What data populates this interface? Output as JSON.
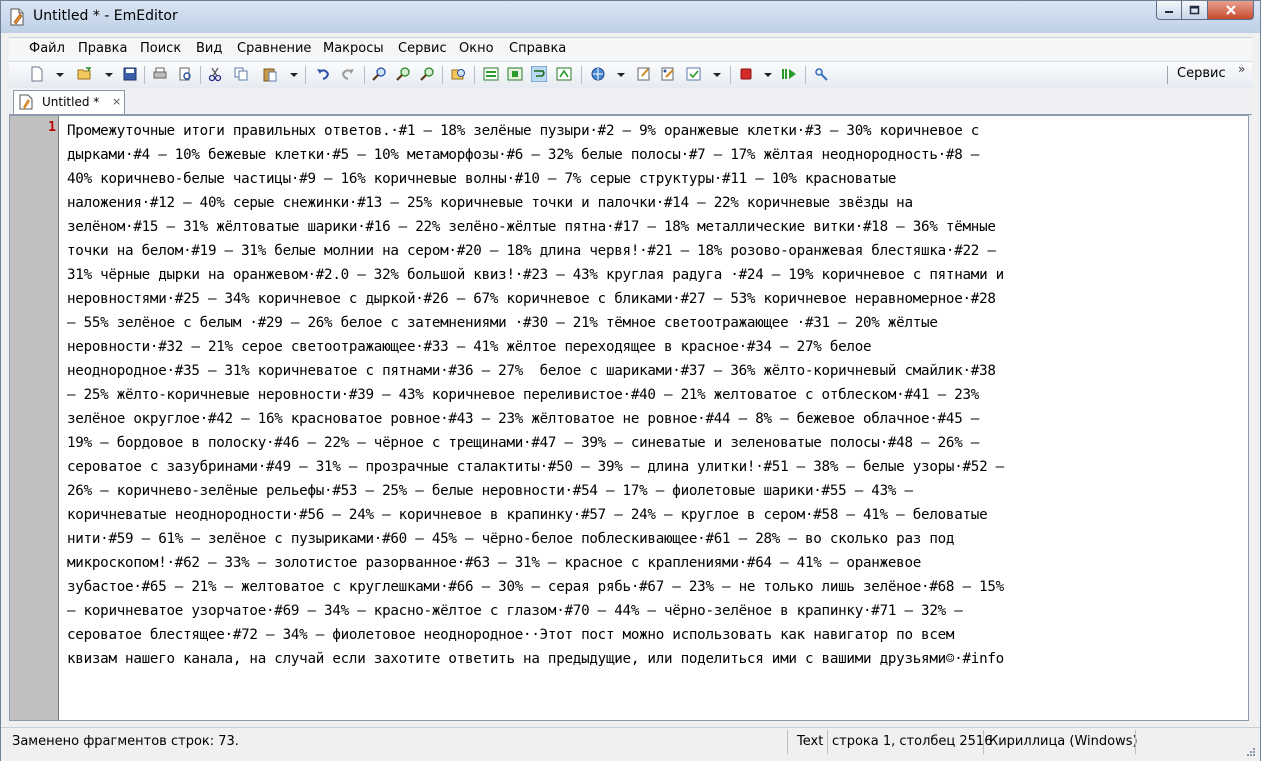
{
  "window": {
    "title": "Untitled * - EmEditor"
  },
  "menu": [
    "Файл",
    "Правка",
    "Поиск",
    "Вид",
    "Сравнение",
    "Макросы",
    "Сервис",
    "Окно",
    "Справка"
  ],
  "toolbar": {
    "service_label": "Сервис",
    "chevron": "»"
  },
  "tab": {
    "label": "Untitled *",
    "close": "×"
  },
  "editor": {
    "line_number": "1",
    "lines": [
      "Промежуточные итоги правильных ответов.·#1 – 18% зелёные пузыри·#2 – 9% оранжевые клетки·#3 – 30% коричневое с",
      "дырками·#4 – 10% бежевые клетки·#5 – 10% метаморфозы·#6 – 32% белые полосы·#7 – 17% жёлтая неоднородность·#8 –",
      "40% коричнево-белые частицы·#9 – 16% коричневые волны·#10 – 7% серые структуры·#11 – 10% красноватые",
      "наложения·#12 – 40% серые снежинки·#13 – 25% коричневые точки и палочки·#14 – 22% коричневые звёзды на",
      "зелёном·#15 – 31% жёлтоватые шарики·#16 – 22% зелёно-жёлтые пятна·#17 – 18% металлические витки·#18 – 36% тёмные",
      "точки на белом·#19 – 31% белые молнии на сером·#20 – 18% длина червя!·#21 – 18% розово-оранжевая блестяшка·#22 –",
      "31% чёрные дырки на оранжевом·#2.0 – 32% большой квиз!·#23 – 43% круглая радуга ·#24 – 19% коричневое с пятнами и",
      "неровностями·#25 – 34% коричневое с дыркой·#26 – 67% коричневое с бликами·#27 – 53% коричневое неравномерное·#28",
      "– 55% зелёное с белым ·#29 – 26% белое с затемнениями ·#30 – 21% тёмное светоотражающее ·#31 – 20% жёлтые",
      "неровности·#32 – 21% серое светоотражающее·#33 – 41% жёлтое переходящее в красное·#34 – 27% белое",
      "неоднородное·#35 – 31% коричневатое с пятнами·#36 – 27%  белое с шариками·#37 – 36% жёлто-коричневый смайлик·#38",
      "– 25% жёлто-коричневые неровности·#39 – 43% коричневое переливистое·#40 – 21% желтоватое с отблеском·#41 – 23%",
      "зелёное округлое·#42 – 16% красноватое ровное·#43 – 23% жёлтоватое не ровное·#44 – 8% – бежевое облачное·#45 –",
      "19% – бордовое в полоску·#46 – 22% – чёрное с трещинами·#47 – 39% – синеватые и зеленоватые полосы·#48 – 26% –",
      "сероватое с зазубринами·#49 – 31% – прозрачные сталактиты·#50 – 39% – длина улитки!·#51 – 38% – белые узоры·#52 –",
      "26% – коричнево-зелёные рельефы·#53 – 25% – белые неровности·#54 – 17% – фиолетовые шарики·#55 – 43% –",
      "коричневатые неоднородности·#56 – 24% – коричневое в крапинку·#57 – 24% – круглое в сером·#58 – 41% – беловатые",
      "нити·#59 – 61% – зелёное с пузыриками·#60 – 45% – чёрно-белое поблескивающее·#61 – 28% – во сколько раз под",
      "микроскопом!·#62 – 33% – золотистое разорванное·#63 – 31% – красное с краплениями·#64 – 41% – оранжевое",
      "зубастое·#65 – 21% – желтоватое с круглешками·#66 – 30% – серая рябь·#67 – 23% – не только лишь зелёное·#68 – 15%",
      "– коричневатое узорчатое·#69 – 34% – красно-жёлтое с глазом·#70 – 44% – чёрно-зелёное в крапинку·#71 – 32% –",
      "сероватое блестящее·#72 – 34% – фиолетовое неоднородное··Этот пост можно использовать как навигатор по всем",
      "квизам нашего канала, на случай если захотите ответить на предыдущие, или поделиться ими с вашими друзьями☺·#info"
    ]
  },
  "status": {
    "message": "Заменено фрагментов строк: 73.",
    "mode": "Text",
    "position": "строка 1, столбец 2516",
    "encoding": "Кириллица (Windows)"
  }
}
